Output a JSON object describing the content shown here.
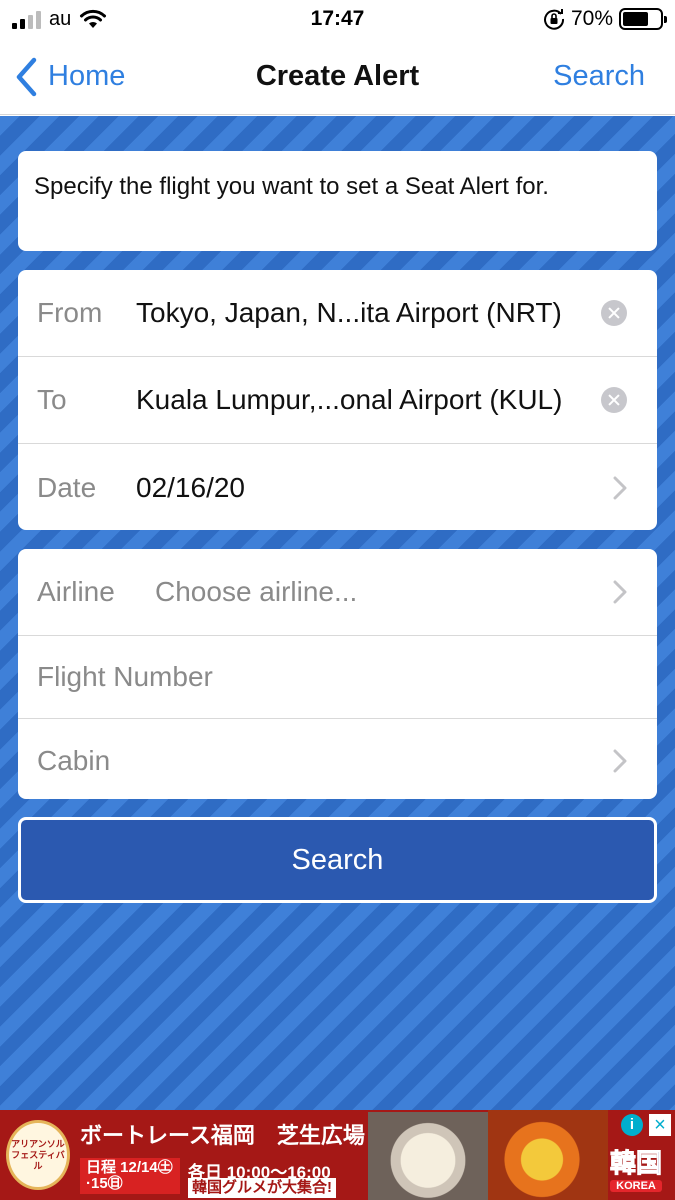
{
  "status_bar": {
    "carrier": "au",
    "time": "17:47",
    "battery_percent_label": "70%",
    "battery_level": 0.7,
    "icons": [
      "signal-icon",
      "wifi-icon",
      "orientation-lock-icon",
      "battery-icon"
    ]
  },
  "nav": {
    "back_label": "Home",
    "title": "Create Alert",
    "action_label": "Search"
  },
  "intro_text": "Specify the flight you want to set a Seat Alert for.",
  "route": {
    "from_label": "From",
    "from_value": "Tokyo, Japan, N...ita Airport (NRT)",
    "to_label": "To",
    "to_value": "Kuala Lumpur,...onal Airport (KUL)",
    "date_label": "Date",
    "date_value": "02/16/20"
  },
  "details": {
    "airline_label": "Airline",
    "airline_placeholder": "Choose airline...",
    "flight_number_placeholder": "Flight Number",
    "cabin_label": "Cabin"
  },
  "search_button_label": "Search",
  "ad": {
    "logo_text": "アリアンソル フェスティバル",
    "title": "ボートレース福岡　芝生広場",
    "date_text": "日程 12/14㊏·15㊐",
    "time_text": "各日 10:00〜16:00",
    "tagline": "韓国グルメが大集合!",
    "korea_text": "韓国",
    "korea_sub": "KOREA",
    "info_glyph": "i",
    "close_glyph": "×"
  },
  "colors": {
    "accent": "#2f7fe0",
    "background_blue": "#3575cf",
    "button_blue": "#2b59b0",
    "ad_red": "#a51816"
  }
}
